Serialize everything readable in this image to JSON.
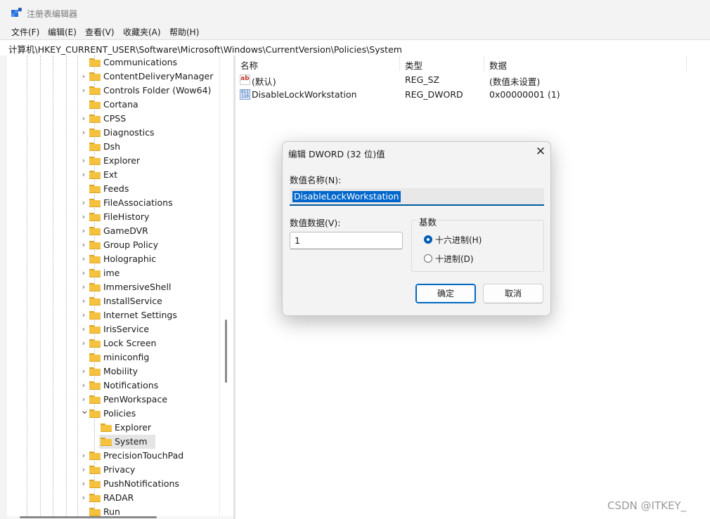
{
  "window": {
    "title": "注册表编辑器"
  },
  "menu": [
    "文件(F)",
    "编辑(E)",
    "查看(V)",
    "收藏夹(A)",
    "帮助(H)"
  ],
  "address": "计算机\\HKEY_CURRENT_USER\\Software\\Microsoft\\Windows\\CurrentVersion\\Policies\\System",
  "tree": {
    "items": [
      {
        "label": "Communications",
        "depth": 0,
        "expander": "none"
      },
      {
        "label": "ContentDeliveryManager",
        "depth": 0,
        "expander": "collapsed"
      },
      {
        "label": "Controls Folder (Wow64)",
        "depth": 0,
        "expander": "collapsed"
      },
      {
        "label": "Cortana",
        "depth": 0,
        "expander": "none"
      },
      {
        "label": "CPSS",
        "depth": 0,
        "expander": "collapsed"
      },
      {
        "label": "Diagnostics",
        "depth": 0,
        "expander": "collapsed"
      },
      {
        "label": "Dsh",
        "depth": 0,
        "expander": "none"
      },
      {
        "label": "Explorer",
        "depth": 0,
        "expander": "collapsed"
      },
      {
        "label": "Ext",
        "depth": 0,
        "expander": "collapsed"
      },
      {
        "label": "Feeds",
        "depth": 0,
        "expander": "none"
      },
      {
        "label": "FileAssociations",
        "depth": 0,
        "expander": "collapsed"
      },
      {
        "label": "FileHistory",
        "depth": 0,
        "expander": "collapsed"
      },
      {
        "label": "GameDVR",
        "depth": 0,
        "expander": "collapsed"
      },
      {
        "label": "Group Policy",
        "depth": 0,
        "expander": "collapsed"
      },
      {
        "label": "Holographic",
        "depth": 0,
        "expander": "collapsed"
      },
      {
        "label": "ime",
        "depth": 0,
        "expander": "collapsed"
      },
      {
        "label": "ImmersiveShell",
        "depth": 0,
        "expander": "collapsed"
      },
      {
        "label": "InstallService",
        "depth": 0,
        "expander": "collapsed"
      },
      {
        "label": "Internet Settings",
        "depth": 0,
        "expander": "collapsed"
      },
      {
        "label": "IrisService",
        "depth": 0,
        "expander": "collapsed"
      },
      {
        "label": "Lock Screen",
        "depth": 0,
        "expander": "collapsed"
      },
      {
        "label": "miniconfig",
        "depth": 0,
        "expander": "none"
      },
      {
        "label": "Mobility",
        "depth": 0,
        "expander": "collapsed"
      },
      {
        "label": "Notifications",
        "depth": 0,
        "expander": "collapsed"
      },
      {
        "label": "PenWorkspace",
        "depth": 0,
        "expander": "collapsed"
      },
      {
        "label": "Policies",
        "depth": 0,
        "expander": "expanded"
      },
      {
        "label": "Explorer",
        "depth": 1,
        "expander": "none"
      },
      {
        "label": "System",
        "depth": 1,
        "expander": "none",
        "selected": true
      },
      {
        "label": "PrecisionTouchPad",
        "depth": 0,
        "expander": "collapsed"
      },
      {
        "label": "Privacy",
        "depth": 0,
        "expander": "collapsed"
      },
      {
        "label": "PushNotifications",
        "depth": 0,
        "expander": "collapsed"
      },
      {
        "label": "RADAR",
        "depth": 0,
        "expander": "collapsed"
      },
      {
        "label": "Run",
        "depth": 0,
        "expander": "none"
      }
    ]
  },
  "list": {
    "columns": [
      "名称",
      "类型",
      "数据"
    ],
    "rows": [
      {
        "icon": "string-value-icon",
        "name": "(默认)",
        "type": "REG_SZ",
        "data": "(数值未设置)"
      },
      {
        "icon": "binary-value-icon",
        "name": "DisableLockWorkstation",
        "type": "REG_DWORD",
        "data": "0x00000001 (1)"
      }
    ]
  },
  "dialog": {
    "title": "编辑 DWORD (32 位)值",
    "name_label": "数值名称(N):",
    "name_value": "DisableLockWorkstation",
    "data_label": "数值数据(V):",
    "data_value": "1",
    "base_label": "基数",
    "radio_hex": "十六进制(H)",
    "radio_dec": "十进制(D)",
    "selected_base": "hex",
    "ok": "确定",
    "cancel": "取消"
  },
  "watermark": "CSDN @ITKEY_",
  "colors": {
    "accent": "#005fb8",
    "folder": "#f5c240",
    "selection": "#0066cc"
  }
}
